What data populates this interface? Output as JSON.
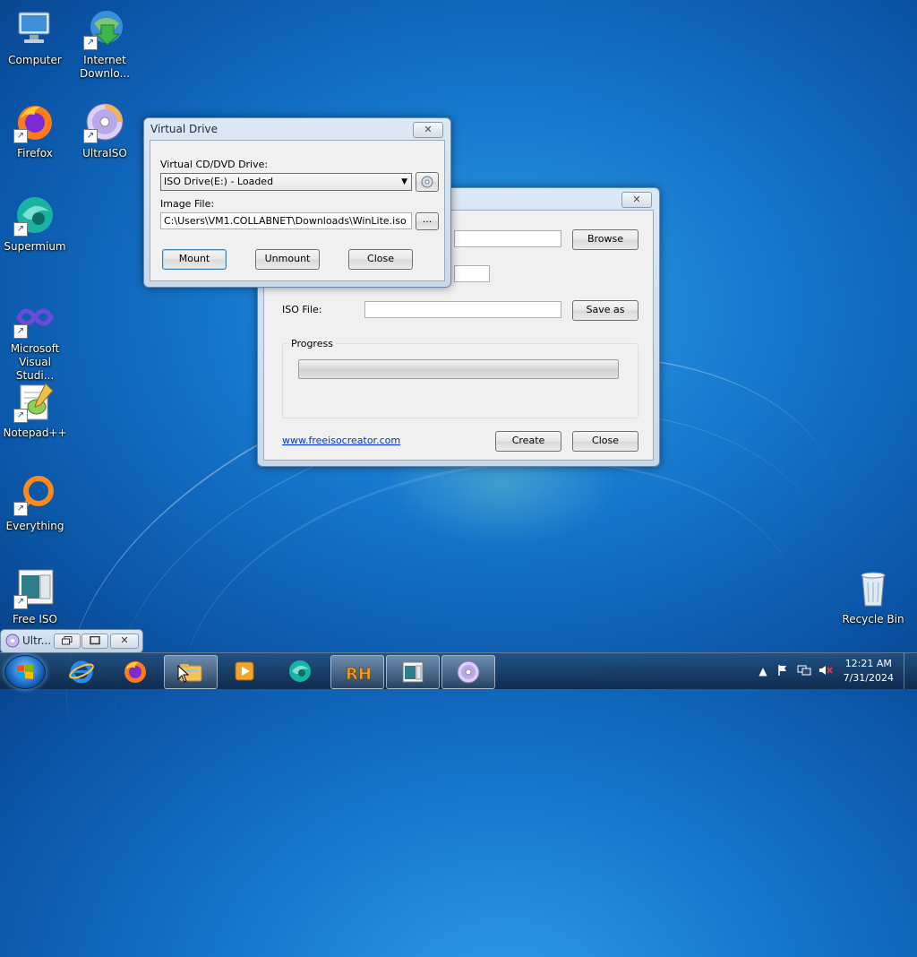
{
  "desktop": {
    "icons": [
      {
        "label": "Computer",
        "icon": "computer-icon"
      },
      {
        "label": "Internet\nDownlo...",
        "icon": "internet-download-manager-icon"
      },
      {
        "label": "Firefox",
        "icon": "firefox-icon"
      },
      {
        "label": "UltraISO",
        "icon": "ultraiso-disc-icon"
      },
      {
        "label": "Supermium",
        "icon": "supermium-icon"
      },
      {
        "label": "Microsoft\nVisual Studi...",
        "icon": "visual-studio-icon"
      },
      {
        "label": "Notepad++",
        "icon": "notepadpp-icon"
      },
      {
        "label": "Everything",
        "icon": "everything-search-icon"
      },
      {
        "label": "Free ISO",
        "icon": "free-iso-creator-icon"
      },
      {
        "label": "Recycle Bin",
        "icon": "recycle-bin-icon"
      }
    ]
  },
  "virtual_drive": {
    "title": "Virtual Drive",
    "close_glyph": "✕",
    "drive_label": "Virtual CD/DVD Drive:",
    "drive_value": "ISO Drive(E:) - Loaded",
    "image_label": "Image File:",
    "image_value": "C:\\Users\\VM1.COLLABNET\\Downloads\\WinLite.iso",
    "browse_glyph": "...",
    "mount": "Mount",
    "unmount": "Unmount",
    "close": "Close"
  },
  "iso_creator": {
    "close_glyph": "✕",
    "browse": "Browse",
    "iso_file_label": "ISO File:",
    "iso_file_value": "",
    "save_as": "Save as",
    "progress_label": "Progress",
    "progress": 0,
    "link": "www.freeisocreator.com",
    "create": "Create",
    "close": "Close"
  },
  "minimized": {
    "label": "Ultr..."
  },
  "taskbar": {
    "apps": [
      "internet-explorer-icon",
      "firefox-icon",
      "file-explorer-icon",
      "media-player-icon",
      "supermium-icon",
      "rh-app-icon",
      "free-iso-creator-icon",
      "ultraiso-disc-icon"
    ],
    "time": "12:21 AM",
    "date": "7/31/2024"
  },
  "colors": {
    "link": "#0033cc",
    "desktop": "#1576cc"
  }
}
